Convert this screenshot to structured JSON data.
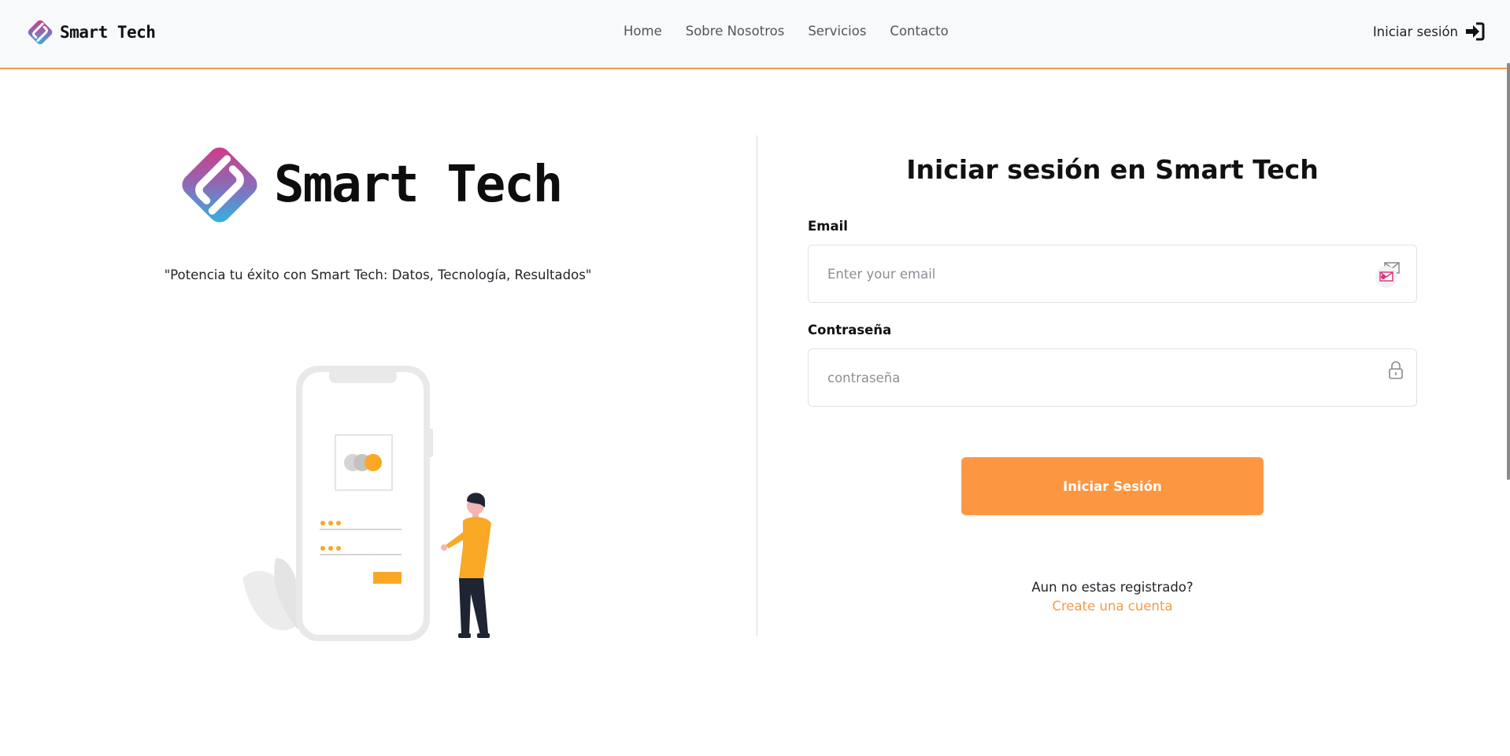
{
  "navbar": {
    "brand": "Smart Tech",
    "links": [
      "Home",
      "Sobre Nosotros",
      "Servicios",
      "Contacto"
    ],
    "login": "Iniciar sesión",
    "accent_color": "#f39c47"
  },
  "hero": {
    "brand": "Smart Tech",
    "tagline": "\"Potencia tu éxito con Smart Tech: Datos, Tecnología, Resultados\""
  },
  "form": {
    "title": "Iniciar sesión en Smart Tech",
    "email_label": "Email",
    "email_placeholder": "Enter your email",
    "email_icon": "mail-icon",
    "password_label": "Contraseña",
    "password_placeholder": "contraseña",
    "password_icon": "lock-icon",
    "submit": "Iniciar Sesión",
    "button_color": "#fd9640",
    "register_question": "Aun no estas registrado?",
    "register_link": "Create una cuenta"
  }
}
